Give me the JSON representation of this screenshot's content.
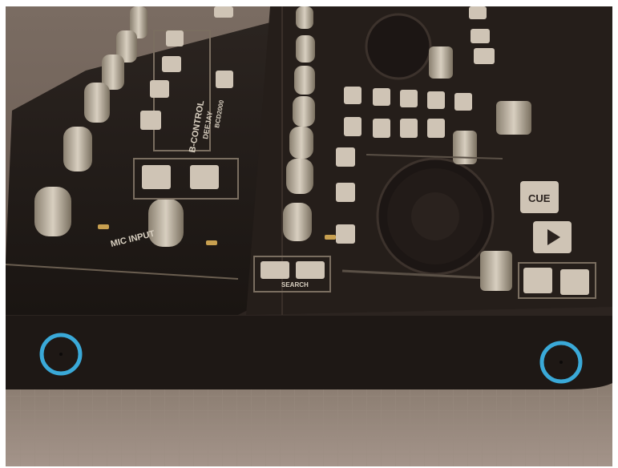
{
  "photo": {
    "subject": "DJ controller",
    "highlight_color": "#3aa9d8",
    "printed_labels": {
      "mic_input": "MIC INPUT",
      "cue": "CUE",
      "search": "SEARCH",
      "brand": "B-CONTROL",
      "model": "DEEJAY",
      "model_code": "BCD2000"
    }
  },
  "markers": [
    {
      "name": "left-screw-marker"
    },
    {
      "name": "right-screw-marker"
    }
  ]
}
